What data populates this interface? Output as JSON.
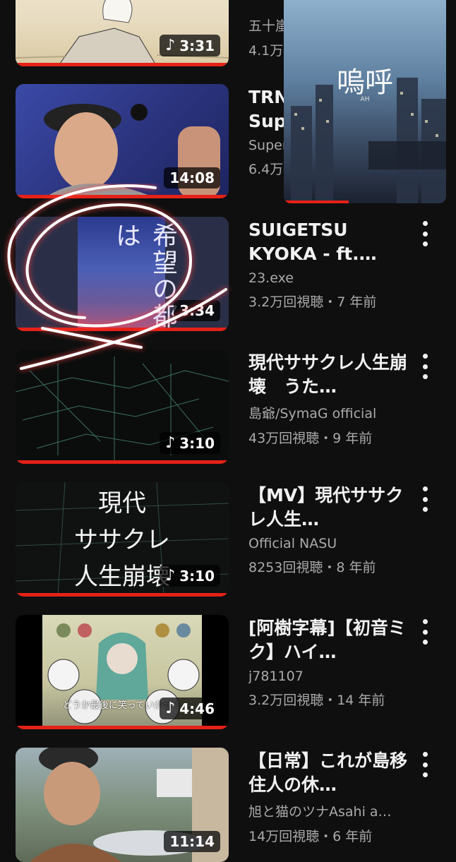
{
  "videos": [
    {
      "title_partial": "五十嵐",
      "stats_partial": "4.1万",
      "duration": "3:31",
      "icon": "music-note-icon"
    },
    {
      "title_line1": "TRN",
      "title_line2": "Sup",
      "channel_partial": "Super",
      "stats_partial": "6.4万",
      "duration": "14:08"
    },
    {
      "title": "SUIGETSU KYOKA - ft.…",
      "channel": "23.exe",
      "stats": "3.2万回視聴・7 年前",
      "duration": "3:34",
      "thumb_text": "希望の都は"
    },
    {
      "title": "現代ササクレ人生崩壊　うた…",
      "channel": "島爺/SymaG official",
      "stats": "43万回視聴・9 年前",
      "duration": "3:10",
      "icon": "music-note-icon"
    },
    {
      "title": "【MV】現代ササクレ人生…",
      "channel": "Official NASU",
      "stats": "8253回視聴・8 年前",
      "duration": "3:10",
      "icon": "music-note-icon",
      "thumb_lines": [
        "現代",
        "ササクレ",
        "人生崩壊"
      ]
    },
    {
      "title": "[阿樹字幕]【初音ミク】ハイ…",
      "channel": "j781107",
      "stats": "3.2万回視聴・14 年前",
      "duration": "4:46",
      "icon": "music-note-icon",
      "thumb_subtitle": "どうか最後に笑っていかせて"
    },
    {
      "title": "【日常】これが島移住人の休…",
      "channel": "旭と猫のツナAsahi a…",
      "stats": "14万回視聴・6 年前",
      "duration": "11:14"
    }
  ],
  "miniplayer": {
    "title": "嗚呼",
    "subtitle": "AH"
  },
  "colors": {
    "background": "#0f0f0f",
    "progress": "#e62117",
    "secondary_text": "#aaaaaa",
    "annotation": "#ffffff"
  }
}
